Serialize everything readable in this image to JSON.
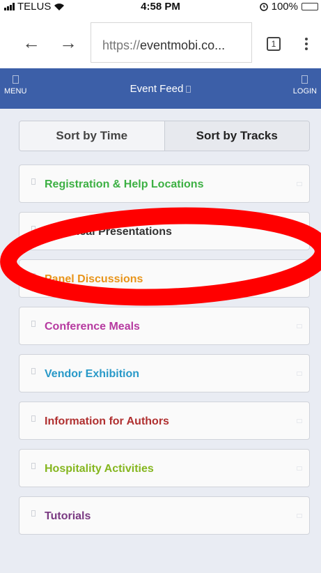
{
  "status_bar": {
    "carrier": "TELUS",
    "time": "4:58 PM",
    "battery": "100%"
  },
  "browser": {
    "url_prefix": "https://",
    "url_domain": "eventmobi.co...",
    "tab_count": "1"
  },
  "header": {
    "menu_label": "MENU",
    "title": "Event Feed",
    "login_label": "LOGIN",
    "color": "#3c5fa8"
  },
  "sort": {
    "options": [
      "Sort by Time",
      "Sort by Tracks"
    ],
    "selected": "Sort by Tracks"
  },
  "tracks": [
    {
      "label": "Registration & Help Locations",
      "color": "#3cb043"
    },
    {
      "label": "Technical Presentations",
      "color": "#333333"
    },
    {
      "label": "Panel Discussions",
      "color": "#e8941a"
    },
    {
      "label": "Conference Meals",
      "color": "#b63aa0"
    },
    {
      "label": "Vendor Exhibition",
      "color": "#2899c8"
    },
    {
      "label": "Information for Authors",
      "color": "#b03030"
    },
    {
      "label": "Hospitality Activities",
      "color": "#85b61f"
    },
    {
      "label": "Tutorials",
      "color": "#7a3a82"
    }
  ],
  "annotation": {
    "shape": "ellipse",
    "color": "#ff0000",
    "highlights": [
      "Technical Presentations",
      "Panel Discussions"
    ]
  }
}
